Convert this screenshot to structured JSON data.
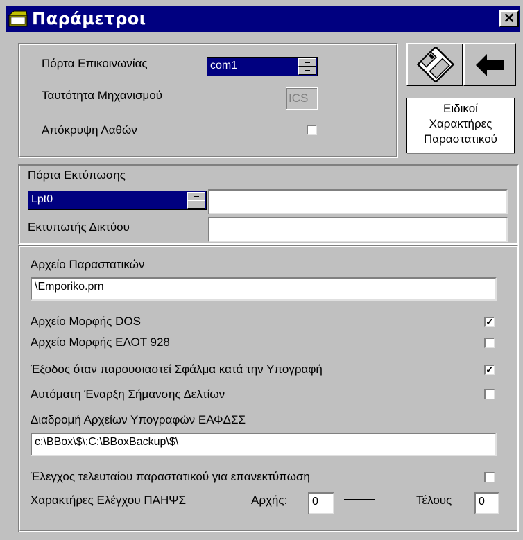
{
  "window": {
    "title": "Παράμετροι",
    "close_glyph": "✕"
  },
  "comm": {
    "port_label": "Πόρτα Επικοινωνίας",
    "port_value": "com1",
    "device_id_label": "Ταυτότητα Μηχανισμού",
    "device_id_value": "ICS",
    "hide_errors_label": "Απόκρυψη Λαθών",
    "hide_errors_checked": false
  },
  "buttons": {
    "save_icon": "floppy-disk-icon",
    "back_icon": "arrow-left-icon",
    "special_chars_lines": [
      "Ειδικοί",
      "Χαρακτήρες",
      "Παραστατικού"
    ]
  },
  "printer": {
    "port_label": "Πόρτα Εκτύπωσης",
    "port_value": "Lpt0",
    "port_extra_value": "",
    "network_label": "Εκτυπωτής Δικτύου",
    "network_value": ""
  },
  "files": {
    "doc_file_label": "Αρχείο Παραστατικών",
    "doc_file_value": "\\Emporiko.prn",
    "options": [
      {
        "label": "Αρχείο Μορφής DOS",
        "checked": true
      },
      {
        "label": "Αρχείο Μορφής ΕΛΟΤ 928",
        "checked": false
      },
      {
        "label": "Έξοδος όταν παρουσιαστεί Σφάλμα κατά την Υπογραφή",
        "checked": true
      },
      {
        "label": "Αυτόματη Έναρξη Σήμανσης Δελτίων",
        "checked": false
      }
    ],
    "signature_path_label": "Διαδρομή Αρχείων Υπογραφών ΕΑΦΔΣΣ",
    "signature_path_value": "c:\\BBox\\$\\;C:\\BBoxBackup\\$\\",
    "last_doc_check_label": "Έλεγχος τελευταίου παραστατικού για επανεκτύπωση",
    "last_doc_check_checked": false,
    "check_chars_label": "Χαρακτήρες Ελέγχου ΠΑΗΨΣ",
    "start_label": "Αρχής:",
    "start_value": "0",
    "end_label": "Τέλους",
    "end_value": "0"
  },
  "colors": {
    "titlebar": "#000080",
    "face": "#c0c0c0",
    "selection": "#000080"
  }
}
